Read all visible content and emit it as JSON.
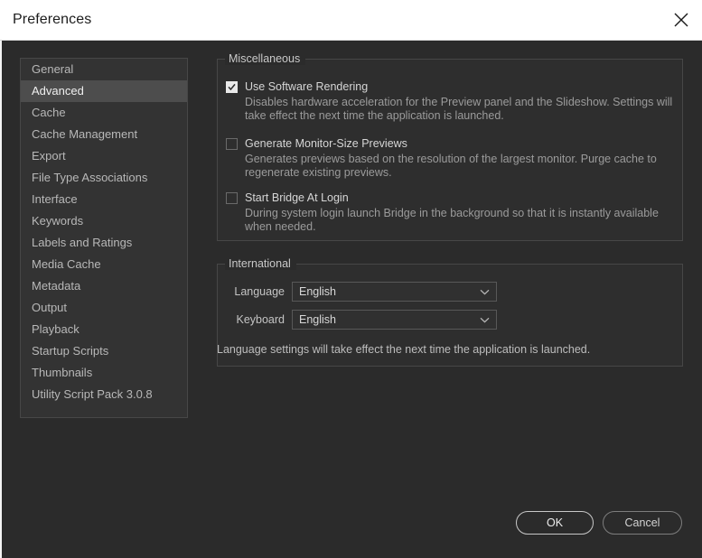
{
  "window": {
    "title": "Preferences",
    "close_icon": "close-icon"
  },
  "sidebar": {
    "items": [
      {
        "label": "General",
        "selected": false
      },
      {
        "label": "Advanced",
        "selected": true
      },
      {
        "label": "Cache",
        "selected": false
      },
      {
        "label": "Cache Management",
        "selected": false
      },
      {
        "label": "Export",
        "selected": false
      },
      {
        "label": "File Type Associations",
        "selected": false
      },
      {
        "label": "Interface",
        "selected": false
      },
      {
        "label": "Keywords",
        "selected": false
      },
      {
        "label": "Labels and Ratings",
        "selected": false
      },
      {
        "label": "Media Cache",
        "selected": false
      },
      {
        "label": "Metadata",
        "selected": false
      },
      {
        "label": "Output",
        "selected": false
      },
      {
        "label": "Playback",
        "selected": false
      },
      {
        "label": "Startup Scripts",
        "selected": false
      },
      {
        "label": "Thumbnails",
        "selected": false
      },
      {
        "label": "Utility Script Pack 3.0.8",
        "selected": false
      }
    ]
  },
  "miscellaneous": {
    "title": "Miscellaneous",
    "options": [
      {
        "label": "Use Software Rendering",
        "checked": true,
        "description": "Disables hardware acceleration for the Preview panel and the Slideshow. Settings will take effect the next time the application is launched."
      },
      {
        "label": "Generate Monitor-Size Previews",
        "checked": false,
        "description": "Generates previews based on the resolution of the largest monitor. Purge cache to regenerate existing previews."
      },
      {
        "label": "Start Bridge At Login",
        "checked": false,
        "description": "During system login launch Bridge in the background so that it is instantly available when needed."
      }
    ]
  },
  "international": {
    "title": "International",
    "language": {
      "label": "Language",
      "value": "English",
      "arrow_icon": "chevron-down-icon"
    },
    "keyboard": {
      "label": "Keyboard",
      "value": "English",
      "arrow_icon": "chevron-down-icon"
    },
    "note": "Language settings will take effect the next time the application is launched."
  },
  "footer": {
    "ok_label": "OK",
    "cancel_label": "Cancel"
  },
  "colors": {
    "dialog_bg": "#2b2b2b",
    "titlebar_bg": "#ffffff",
    "panel_bg": "#2e2e2e",
    "selection": "#4d4d4d",
    "border": "#474747",
    "text": "#d6d6d6",
    "muted_text": "#9b9b9b"
  }
}
